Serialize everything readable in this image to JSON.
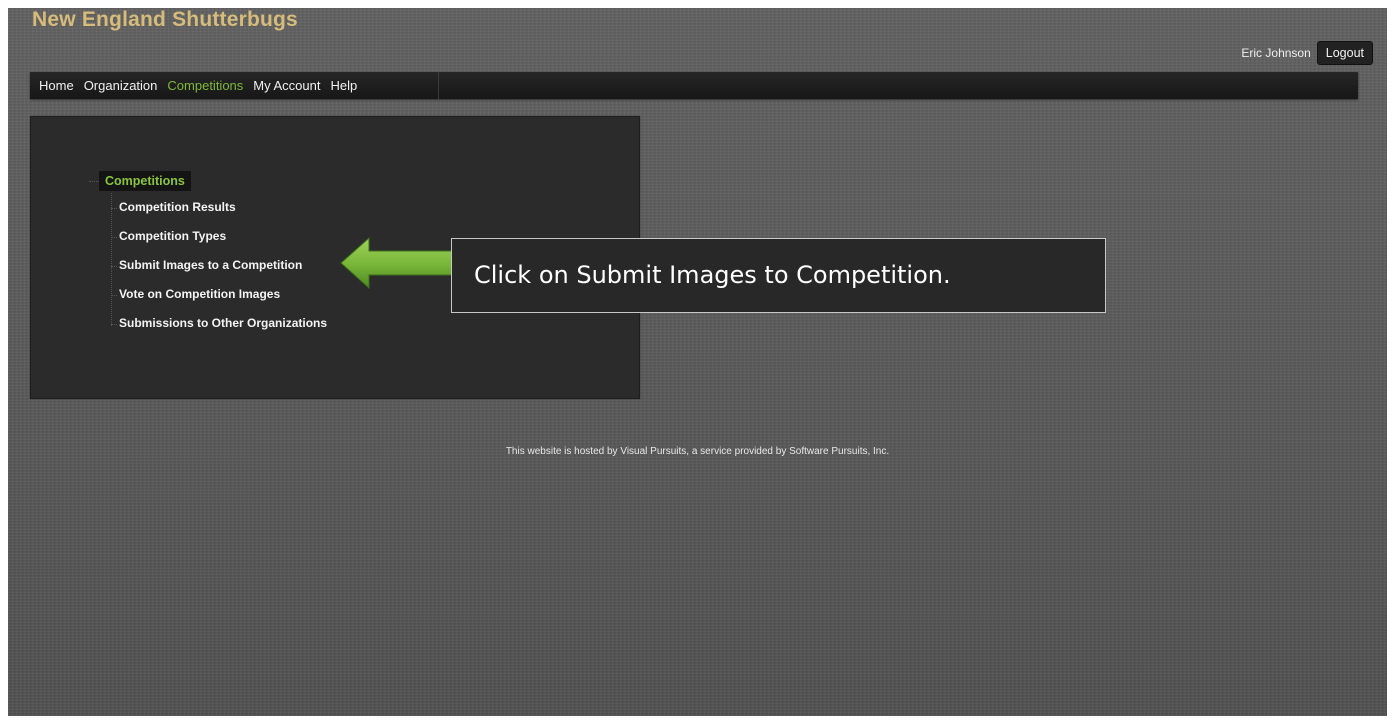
{
  "header": {
    "site_title": "New England Shutterbugs",
    "user_name": "Eric Johnson",
    "logout_label": "Logout"
  },
  "nav": {
    "items": [
      {
        "label": "Home",
        "active": false
      },
      {
        "label": "Organization",
        "active": false
      },
      {
        "label": "Competitions",
        "active": true
      },
      {
        "label": "My Account",
        "active": false
      },
      {
        "label": "Help",
        "active": false
      }
    ]
  },
  "tree": {
    "root_label": "Competitions",
    "children": [
      {
        "label": "Competition Results"
      },
      {
        "label": "Competition Types"
      },
      {
        "label": "Submit Images to a Competition"
      },
      {
        "label": "Vote on Competition Images"
      },
      {
        "label": "Submissions to Other Organizations"
      }
    ]
  },
  "annotation": {
    "callout_text": "Click on Submit Images to Competition.",
    "arrow_icon": "left-arrow-icon",
    "arrow_color": "#7ab83a"
  },
  "footer": {
    "text": "This website is hosted by Visual Pursuits, a service provided by Software Pursuits, Inc."
  },
  "colors": {
    "title": "#d6bb7a",
    "active_nav": "#7fb936",
    "tree_root": "#8bc43f"
  }
}
